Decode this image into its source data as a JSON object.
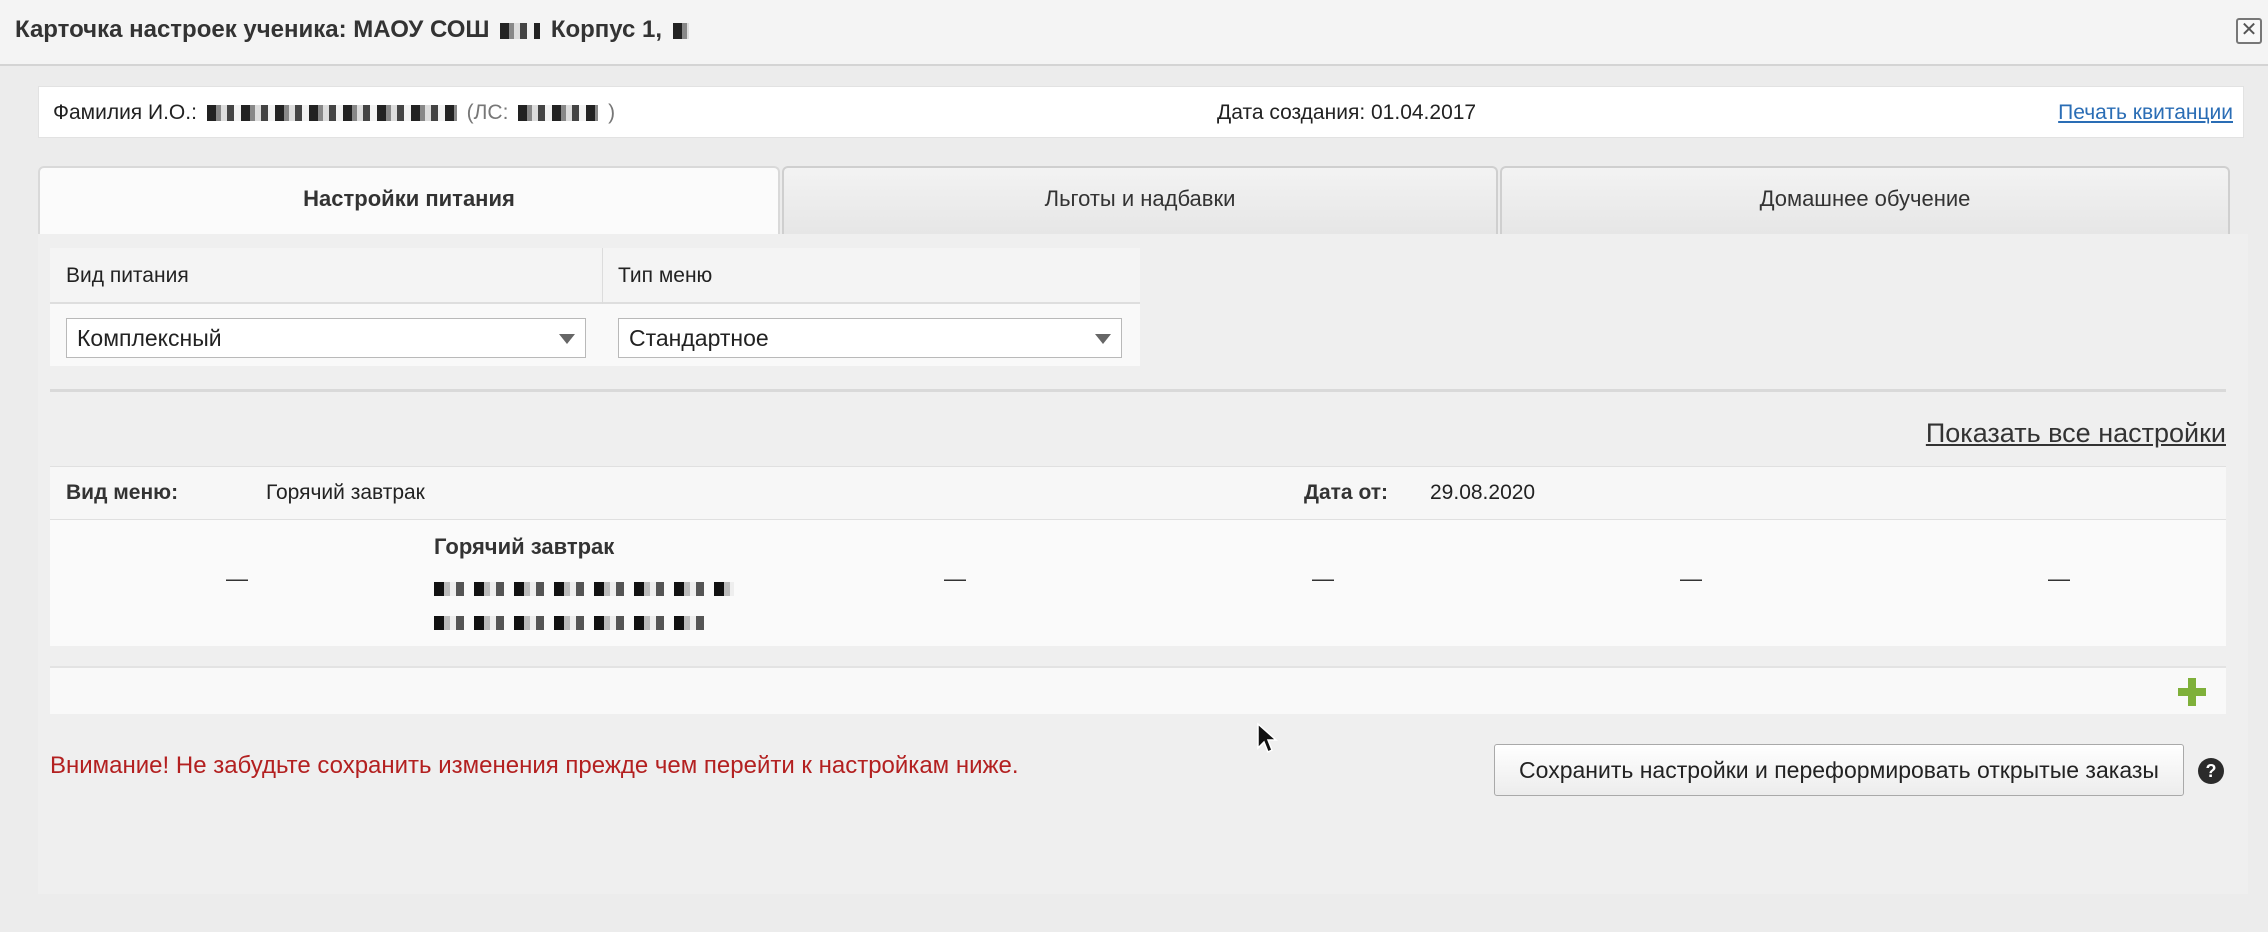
{
  "dialog": {
    "title_prefix": "Карточка настроек ученика: МАОУ СОШ",
    "title_suffix": "Корпус 1,",
    "close_glyph": "✕"
  },
  "info": {
    "fio_label": "Фамилия И.О.:",
    "ls_label": "(ЛС:",
    "ls_close": ")",
    "created_label": "Дата создания:",
    "created_value": "01.04.2017",
    "print_link": "Печать квитанции"
  },
  "tabs": [
    {
      "label": "Настройки питания",
      "active": true
    },
    {
      "label": "Льготы и надбавки",
      "active": false
    },
    {
      "label": "Домашнее обучение",
      "active": false
    }
  ],
  "form": {
    "vid_label": "Вид питания",
    "vid_value": "Комплексный",
    "tip_label": "Тип меню",
    "tip_value": "Стандартное"
  },
  "show_all": "Показать все настройки",
  "menu": {
    "vid_label": "Вид меню:",
    "vid_value": "Горячий завтрак",
    "date_label": "Дата от:",
    "date_value": "29.08.2020",
    "row_title": "Горячий завтрак",
    "dash": "—"
  },
  "warning": "Внимание! Не забудьте сохранить изменения прежде чем перейти к настройкам ниже.",
  "save_button": "Сохранить настройки и переформировать открытые заказы",
  "help_glyph": "?",
  "icons": [
    "close-icon",
    "plus-icon",
    "help-icon",
    "dropdown-caret-icon",
    "mouse-cursor-icon"
  ],
  "colors": {
    "link": "#2a6db5",
    "warning": "#b32020",
    "add_icon": "#7fb03a"
  }
}
